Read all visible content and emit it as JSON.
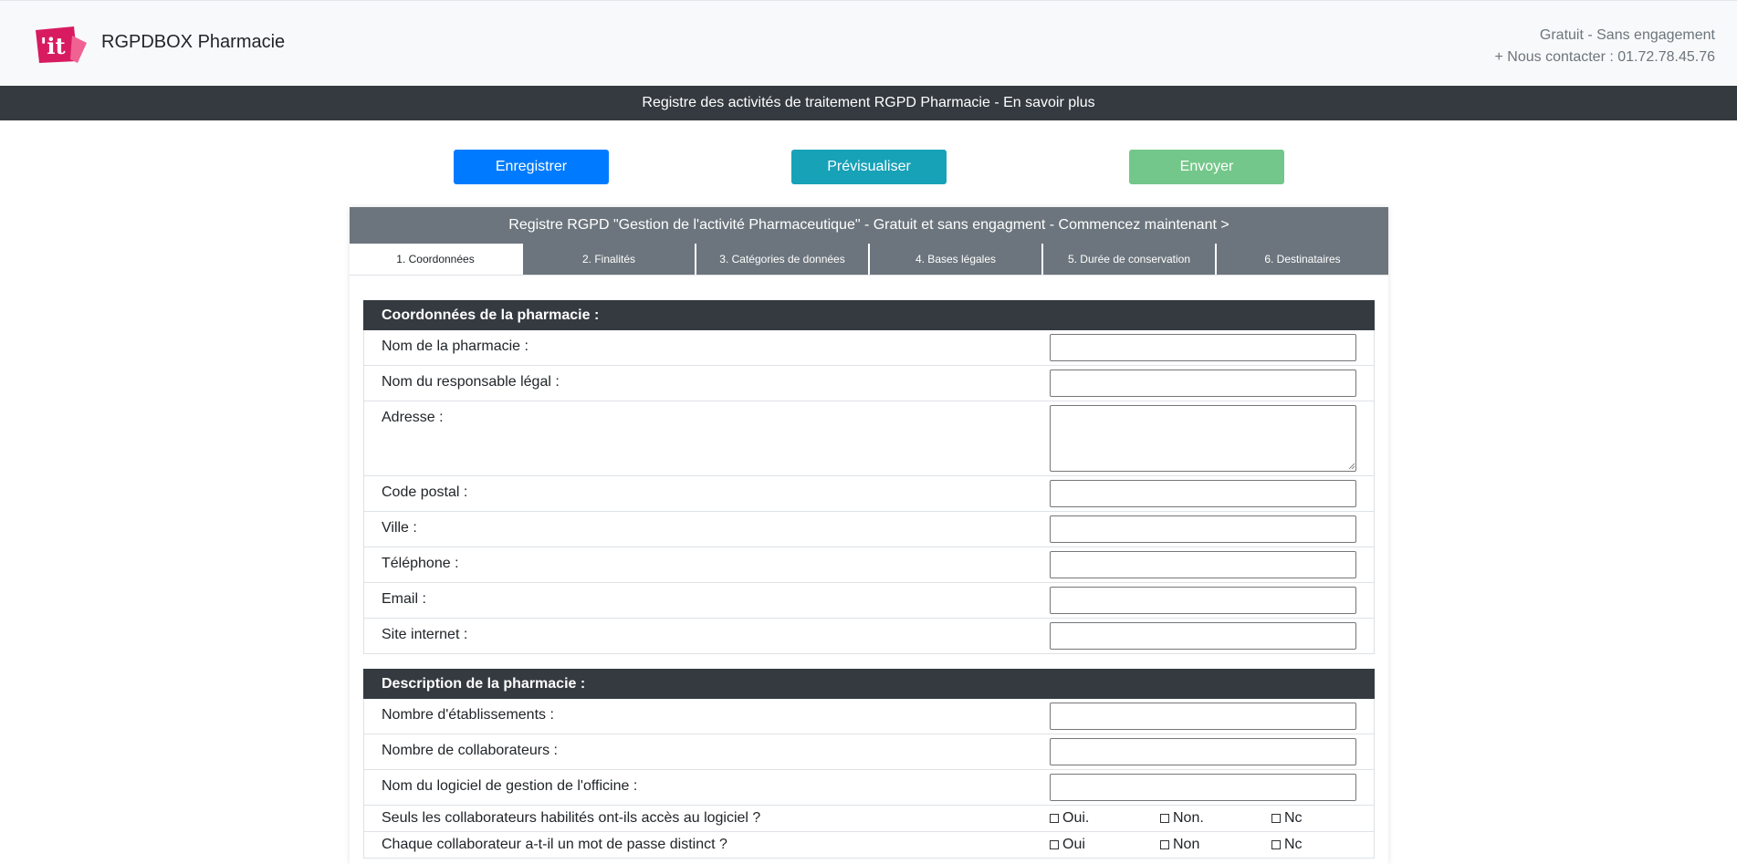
{
  "header": {
    "brand": "RGPDBOX Pharmacie",
    "tagline": "Gratuit - Sans engagement",
    "contact": "+ Nous contacter : 01.72.78.45.76",
    "logo_text": "'it"
  },
  "infobar": {
    "text": "Registre des activités de traitement RGPD Pharmacie - En savoir plus"
  },
  "actions": {
    "save_label": "Enregistrer",
    "preview_label": "Prévisualiser",
    "send_label": "Envoyer"
  },
  "card": {
    "title": "Registre RGPD \"Gestion de l'activité Pharmaceutique\" - Gratuit et sans engagment - Commencez maintenant >",
    "tabs": [
      {
        "label": "1. Coordonnées",
        "active": true
      },
      {
        "label": "2. Finalités",
        "active": false
      },
      {
        "label": "3. Catégories de données",
        "active": false
      },
      {
        "label": "4. Bases légales",
        "active": false
      },
      {
        "label": "5. Durée de conservation",
        "active": false
      },
      {
        "label": "6. Destinataires",
        "active": false
      }
    ]
  },
  "section1": {
    "title": "Coordonnées de la pharmacie :",
    "fields": [
      {
        "label": "Nom de la pharmacie :",
        "value": ""
      },
      {
        "label": "Nom du responsable légal :",
        "value": ""
      },
      {
        "label": "Adresse :",
        "value": ""
      },
      {
        "label": "Code postal :",
        "value": ""
      },
      {
        "label": "Ville :",
        "value": ""
      },
      {
        "label": "Téléphone :",
        "value": ""
      },
      {
        "label": "Email :",
        "value": ""
      },
      {
        "label": "Site internet :",
        "value": ""
      }
    ]
  },
  "section2": {
    "title": "Description de la pharmacie :",
    "fields": [
      {
        "label": "Nombre d'établissements :",
        "value": ""
      },
      {
        "label": "Nombre de collaborateurs :",
        "value": ""
      },
      {
        "label": "Nom du logiciel de gestion de l'officine :",
        "value": ""
      }
    ],
    "questions": [
      {
        "label": "Seuls les collaborateurs habilités ont-ils accès au logiciel ?",
        "options": [
          "Oui.",
          "Non.",
          "Nc"
        ]
      },
      {
        "label": "Chaque collaborateur a-t-il un mot de passe distinct ?",
        "options": [
          "Oui",
          "Non",
          "Nc"
        ]
      }
    ]
  },
  "colors": {
    "primary": "#007bff",
    "info": "#17a2b8",
    "success_light": "#74c78a",
    "dark": "#343a40",
    "secondary": "#6c757d",
    "logo_pink": "#e6186f"
  }
}
